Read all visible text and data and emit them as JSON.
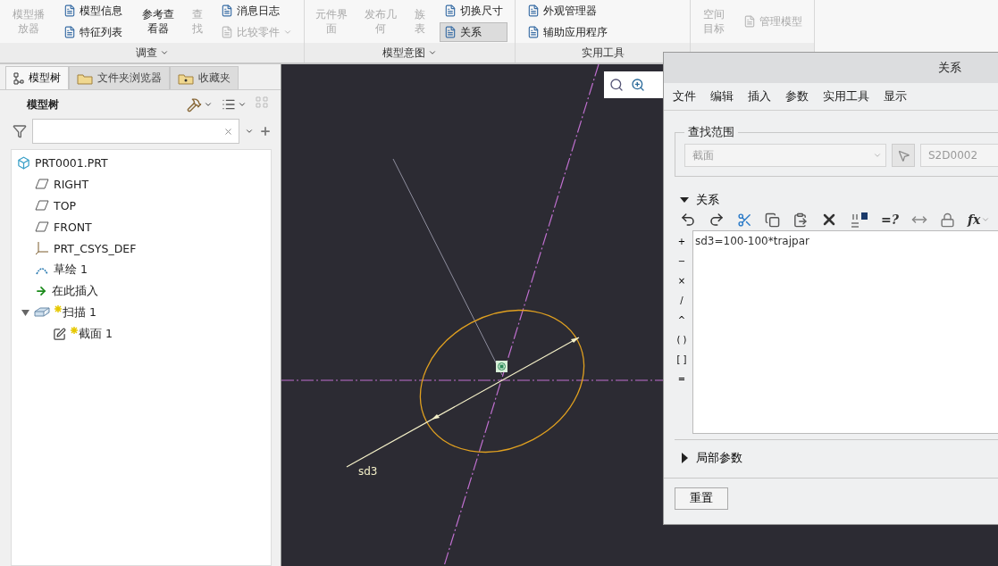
{
  "ribbon": {
    "groups": [
      {
        "label": "调查",
        "menu": true,
        "columns": [
          [
            {
              "label": "模型播放器",
              "kind": "tall",
              "disabled": true,
              "selected": false
            }
          ],
          [
            {
              "label": "模型信息",
              "kind": "small",
              "disabled": false,
              "selected": false
            },
            {
              "label": "特征列表",
              "kind": "small",
              "disabled": false,
              "selected": false
            }
          ],
          [
            {
              "label": "参考查看器",
              "kind": "tall",
              "disabled": false,
              "selected": false
            }
          ],
          [
            {
              "label": "查找",
              "kind": "tall",
              "disabled": true,
              "selected": false
            }
          ],
          [
            {
              "label": "消息日志",
              "kind": "small",
              "disabled": false,
              "selected": false
            },
            {
              "label": "比较零件",
              "kind": "menu",
              "disabled": true,
              "selected": false
            }
          ]
        ]
      },
      {
        "label": "模型意图",
        "menu": true,
        "columns": [
          [
            {
              "label": "元件界面",
              "kind": "tall",
              "disabled": true,
              "selected": false
            }
          ],
          [
            {
              "label": "发布几何",
              "kind": "tall",
              "disabled": true,
              "selected": false
            }
          ],
          [
            {
              "label": "族表",
              "kind": "tall",
              "disabled": true,
              "selected": false
            }
          ],
          [
            {
              "label": "切换尺寸",
              "kind": "small",
              "disabled": false,
              "selected": false
            },
            {
              "label": "关系",
              "kind": "small",
              "disabled": false,
              "selected": true
            }
          ]
        ]
      },
      {
        "label": "实用工具",
        "menu": false,
        "columns": [
          [
            {
              "label": "外观管理器",
              "kind": "small",
              "disabled": false,
              "selected": false
            },
            {
              "label": "辅助应用程序",
              "kind": "small",
              "disabled": false,
              "selected": false
            }
          ]
        ]
      },
      {
        "menu": false,
        "columns": [
          [
            {
              "label": "空间目标",
              "kind": "tall",
              "disabled": true,
              "selected": false
            }
          ],
          [
            {
              "label": "管理模型",
              "kind": "small",
              "disabled": true,
              "selected": false
            }
          ]
        ]
      }
    ]
  },
  "navigator": {
    "tabs": [
      {
        "label": "模型树",
        "kind": "tree",
        "selected": true
      },
      {
        "label": "文件夹浏览器",
        "kind": "folder",
        "selected": false
      },
      {
        "label": "收藏夹",
        "kind": "favorites",
        "selected": false
      }
    ],
    "header": "模型树",
    "tree": [
      {
        "label": "PRT0001.PRT",
        "kind": "part",
        "new": false,
        "children": [
          {
            "label": "RIGHT",
            "kind": "plane",
            "new": false
          },
          {
            "label": "TOP",
            "kind": "plane",
            "new": false
          },
          {
            "label": "FRONT",
            "kind": "plane",
            "new": false
          },
          {
            "label": "PRT_CSYS_DEF",
            "kind": "csys",
            "new": false
          },
          {
            "label": "草绘 1",
            "kind": "sketch",
            "new": false
          },
          {
            "label": "在此插入",
            "kind": "insert",
            "new": false
          },
          {
            "label": "扫描 1",
            "kind": "sweep",
            "new": true,
            "expanded": true,
            "children": [
              {
                "label": "截面 1",
                "kind": "section",
                "new": true
              }
            ]
          }
        ]
      }
    ]
  },
  "canvas": {
    "dimension_label": "sd3"
  },
  "dialog": {
    "title": "关系",
    "menu": [
      "文件",
      "编辑",
      "插入",
      "参数",
      "实用工具",
      "显示"
    ],
    "scope": {
      "legend": "查找范围",
      "type_value": "截面",
      "target_value": "S2D0002"
    },
    "relations": {
      "label": "关系",
      "expanded": true,
      "tools": [
        {
          "kind": "undo"
        },
        {
          "kind": "redo"
        },
        {
          "kind": "cut"
        },
        {
          "kind": "copy"
        },
        {
          "kind": "paste"
        },
        {
          "kind": "delete"
        },
        {
          "kind": "parameter"
        },
        {
          "kind": "text",
          "label": "=?"
        },
        {
          "kind": "measure"
        },
        {
          "kind": "lock"
        },
        {
          "kind": "text",
          "label": "fx",
          "menu": true
        }
      ],
      "operators": [
        "+",
        "−",
        "×",
        "/",
        "^",
        "( )",
        "[ ]",
        "="
      ],
      "text": "sd3=100-100*trajpar"
    },
    "local_params": {
      "label": "局部参数",
      "expanded": false
    },
    "buttons": [
      "重置"
    ]
  }
}
